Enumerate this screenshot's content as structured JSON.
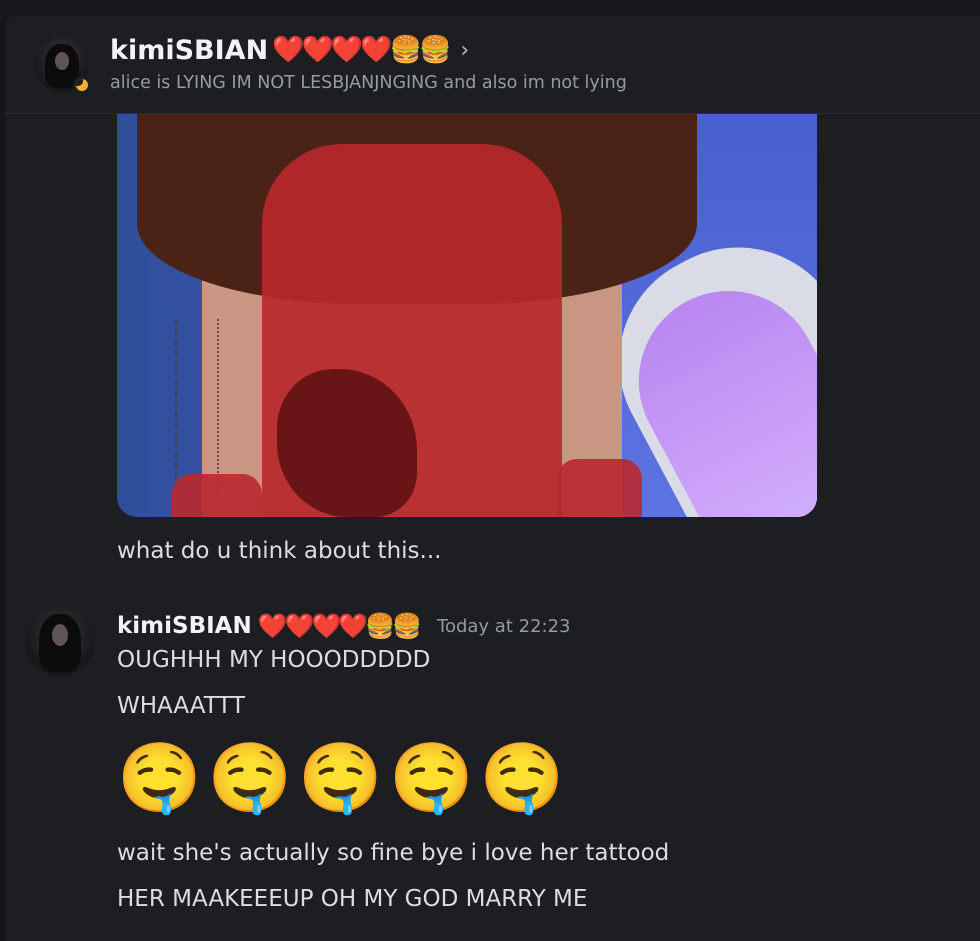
{
  "header": {
    "name": "kimiSBIAN",
    "name_emoji": "❤️❤️❤️❤️🍔🍔",
    "chevron": "›",
    "status": "alice is LYING IM NOT LESBJANJNGING and also im not lying"
  },
  "messages": [
    {
      "caption": "what do u think about this..."
    },
    {
      "author": "kimiSBIAN",
      "author_emoji": "❤️❤️❤️❤️🍔🍔",
      "timestamp": "Today at 22:23",
      "lines": [
        "OUGHHH MY HOOODDDDD",
        "WHAAATTT"
      ],
      "emoji_row": [
        "🤤",
        "🤤",
        "🤤",
        "🤤",
        "🤤"
      ],
      "lines_after": [
        "wait she's actually so fine bye i love her tattood",
        "HER MAAKEEEUP OH MY GOD MARRY ME"
      ]
    }
  ],
  "icons": {
    "status_icon": "moon-idle-icon"
  },
  "colors": {
    "background": "#1d1e22",
    "text": "#dbdee1",
    "muted": "#949ba4",
    "idle": "#f0b232"
  }
}
